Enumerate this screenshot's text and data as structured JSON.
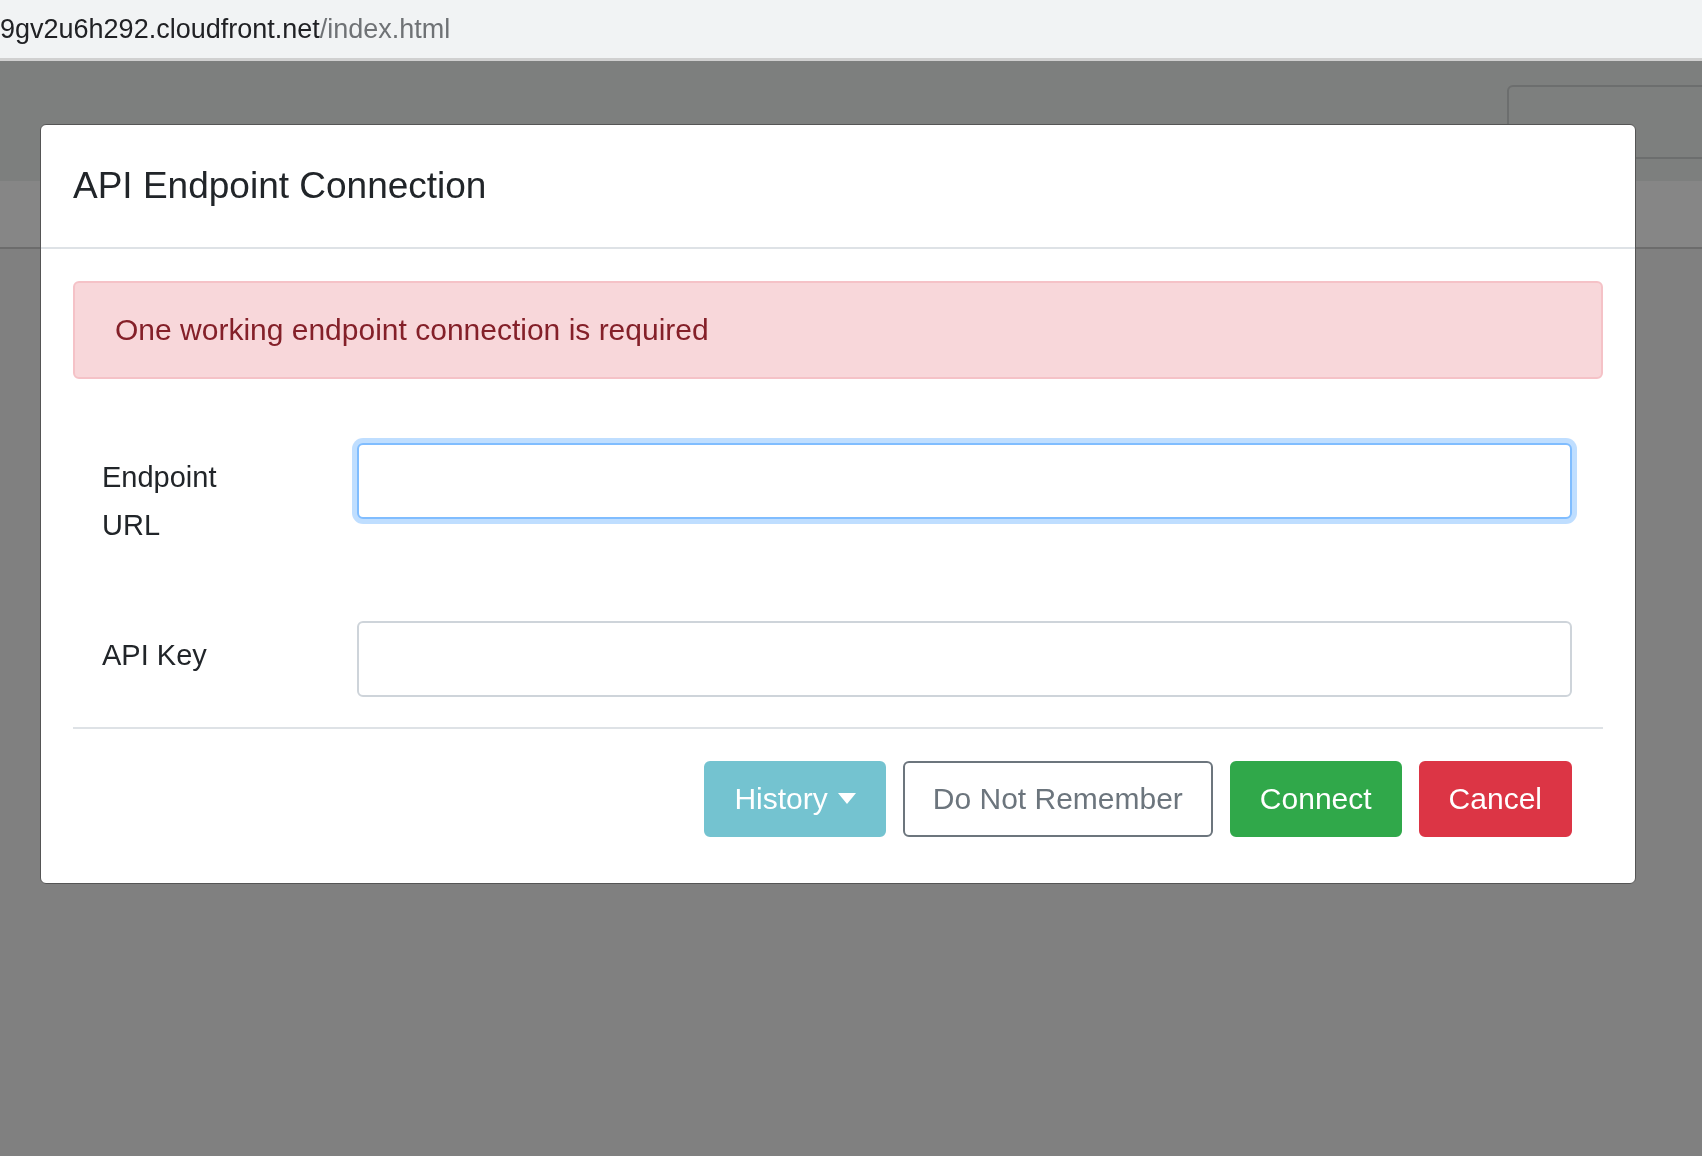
{
  "address_bar": {
    "host": "9gv2u6h292.cloudfront.net",
    "path": "/index.html"
  },
  "dialog": {
    "title": "API Endpoint Connection",
    "alert": "One working endpoint connection is required",
    "fields": [
      {
        "label": "Endpoint URL",
        "focused": true
      },
      {
        "label": "API Key",
        "focused": false
      }
    ],
    "buttons": [
      {
        "label": "History",
        "kind": "dropdown"
      },
      {
        "label": "Do Not Remember",
        "kind": "outline"
      },
      {
        "label": "Connect",
        "kind": "success"
      },
      {
        "label": "Cancel",
        "kind": "danger"
      }
    ]
  }
}
